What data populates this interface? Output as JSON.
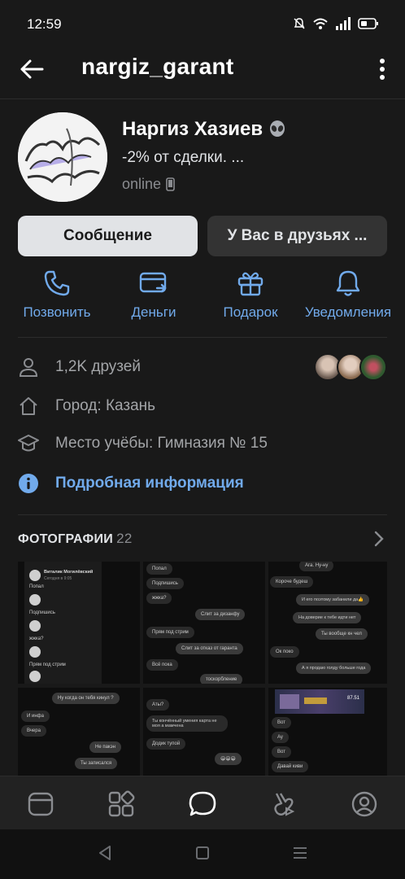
{
  "status_bar": {
    "time": "12:59"
  },
  "header": {
    "title": "nargiz_garant"
  },
  "profile": {
    "name": "Наргиз Хазиев",
    "status": "-2% от сделки. ...",
    "online": "online"
  },
  "buttons": {
    "message": "Сообщение",
    "friends": "У Вас в друзьях ..."
  },
  "actions": [
    {
      "label": "Позвонить",
      "icon": "phone-icon"
    },
    {
      "label": "Деньги",
      "icon": "money-card-icon"
    },
    {
      "label": "Подарок",
      "icon": "gift-icon"
    },
    {
      "label": "Уведомления",
      "icon": "bell-icon"
    }
  ],
  "info": {
    "friends": "1,2K друзей",
    "city": "Город: Казань",
    "school": "Место учёбы: Гимназия № 15",
    "details": "Подробная информация"
  },
  "photos": {
    "title": "ФОТОГРАФИИ",
    "count": "22",
    "p1": {
      "name": "Виталик Могилёвский",
      "seen": "Сегодня в 9:05",
      "msgs": [
        "Попал",
        "Подпишись",
        "жжка?",
        "Прям под стрим"
      ]
    },
    "p2": {
      "msgs_top": [
        "Попал",
        "Подпишись",
        "жжка?",
        "Слит за дизанфу",
        "Прям под стрим",
        "Слит за отказ от гаранта",
        "Всё пока",
        "тоскорбление"
      ]
    },
    "p3": {
      "msgs_top": [
        "Ага. Ну-ну",
        "Короче будеш",
        "И его поэтому забанили да👍",
        "На доверие к тебе идти нет",
        "Ты вообще кн чел",
        "Ок поко",
        "А я продаю голду больше года"
      ]
    },
    "p4": {
      "msgs": [
        "Ну когда он тебя кинул ?",
        "И инфа",
        "Вчера",
        "Не пакэн",
        "Ты записался"
      ]
    },
    "p5": {
      "msgs": [
        "Аты?",
        "Ты кончённый умения карта не моя а мамчена",
        "Додик тупой",
        "😁😁😁"
      ]
    },
    "p6": {
      "msgs": [
        "Вот",
        "Ау",
        "Вот",
        "Давай киви"
      ],
      "game_value": "87.51"
    }
  },
  "bottom_nav": [
    "home-icon",
    "services-icon",
    "messages-icon",
    "clips-icon",
    "profile-icon"
  ],
  "colors": {
    "accent": "#71aaeb",
    "background": "#191919",
    "button_primary": "#e1e3e6"
  }
}
